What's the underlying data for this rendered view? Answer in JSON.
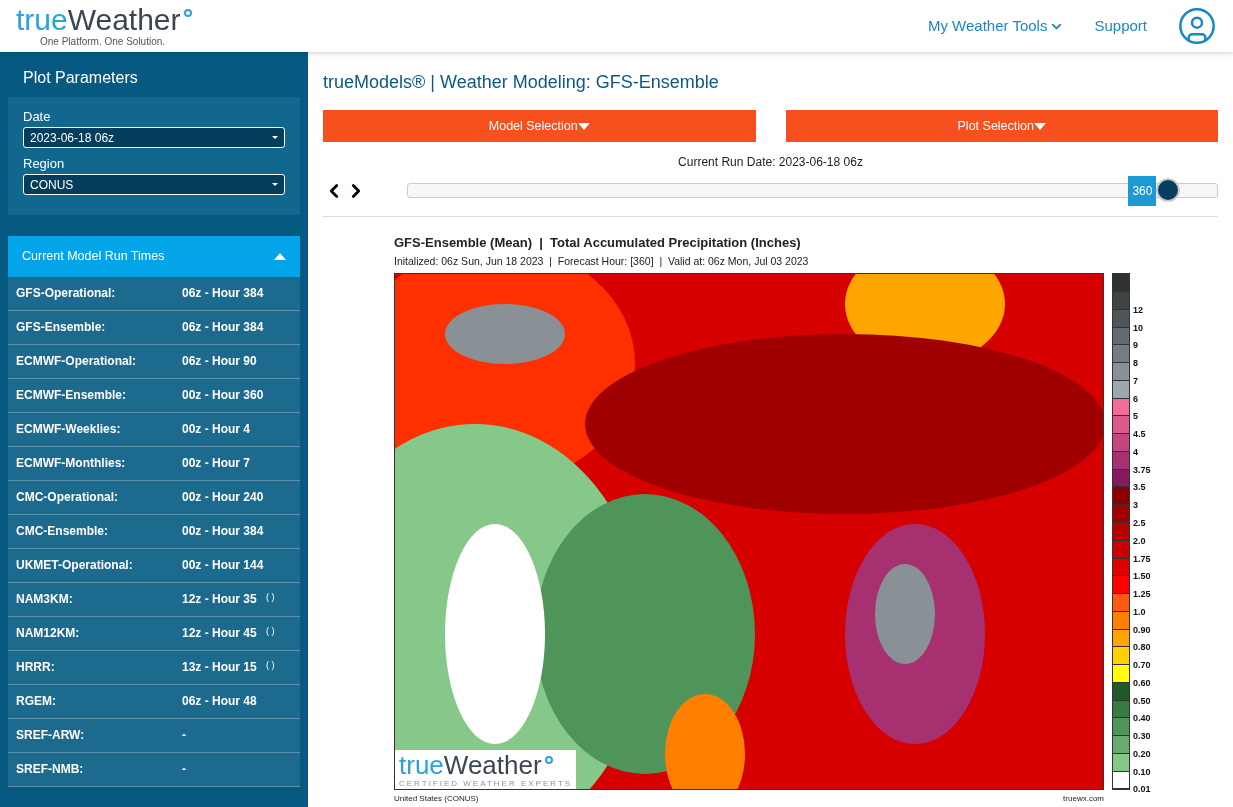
{
  "header": {
    "logo": {
      "first": "true",
      "second": "Weather",
      "tagline": "One Platform. One Solution."
    },
    "nav": [
      {
        "label": "My Weather Tools",
        "kind": "dropdown"
      },
      {
        "label": "Support",
        "kind": "link"
      }
    ]
  },
  "sidebar": {
    "title": "Plot Parameters",
    "fields": [
      {
        "label": "Date",
        "value": "2023-06-18 06z"
      },
      {
        "label": "Region",
        "value": "CONUS"
      }
    ],
    "run_times": {
      "title": "Current Model Run Times",
      "expanded": true,
      "rows": [
        {
          "model": "GFS-Operational:",
          "time": "06z - Hour 384"
        },
        {
          "model": "GFS-Ensemble:",
          "time": "06z - Hour 384"
        },
        {
          "model": "ECMWF-Operational:",
          "time": "06z - Hour 90"
        },
        {
          "model": "ECMWF-Ensemble:",
          "time": "00z - Hour 360"
        },
        {
          "model": "ECMWF-Weeklies:",
          "time": "00z - Hour 4"
        },
        {
          "model": "ECMWF-Monthlies:",
          "time": "00z - Hour 7"
        },
        {
          "model": "CMC-Operational:",
          "time": "00z - Hour 240"
        },
        {
          "model": "CMC-Ensemble:",
          "time": "00z - Hour 384"
        },
        {
          "model": "UKMET-Operational:",
          "time": "00z - Hour 144"
        },
        {
          "model": "NAM3KM:",
          "time": "12z - Hour 35",
          "note": "( )"
        },
        {
          "model": "NAM12KM:",
          "time": "12z - Hour 45",
          "note": "( )"
        },
        {
          "model": "HRRR:",
          "time": "13z - Hour 15",
          "note": "( )"
        },
        {
          "model": "RGEM:",
          "time": "06z - Hour 48"
        },
        {
          "model": "SREF-ARW:",
          "time": "-"
        },
        {
          "model": "SREF-NMB:",
          "time": "-"
        }
      ]
    }
  },
  "main": {
    "title": "trueModels® | Weather Modeling: GFS-Ensemble",
    "buttons": [
      "Model Selection",
      "Plot Selection"
    ],
    "run_date": "Current Run Date: 2023-06-18 06z",
    "slider": {
      "value": "360",
      "level": 0.94
    },
    "plot": {
      "title": "GFS-Ensemble (Mean)  |  Total Accumulated Precipitation (Inches)",
      "subtitle": "Initalized: 06z Sun, Jun 18 2023  |  Forecast Hour: [360]  |  Valid at: 06z Mon, Jul 03 2023",
      "map_logo": {
        "first": "true",
        "second": "Weather",
        "tagline": "CERTIFIED WEATHER EXPERTS"
      },
      "footer_left": "United States (CONUS)",
      "footer_right": "truewx.com",
      "legend": [
        {
          "color": "#2f3331"
        },
        {
          "label": "12",
          "color": "#3f4442"
        },
        {
          "label": "10",
          "color": "#50555a"
        },
        {
          "label": "9",
          "color": "#646a70"
        },
        {
          "label": "8",
          "color": "#767d82"
        },
        {
          "label": "7",
          "color": "#8a9196"
        },
        {
          "label": "6",
          "color": "#9ea7ae"
        },
        {
          "label": "5",
          "color": "#f06d98"
        },
        {
          "label": "4.5",
          "color": "#dc5a8c"
        },
        {
          "label": "4",
          "color": "#c24680"
        },
        {
          "label": "3.75",
          "color": "#a63070"
        },
        {
          "label": "3.5",
          "color": "#871a5c"
        },
        {
          "label": "3",
          "color": "#8a0000"
        },
        {
          "label": "2.5",
          "color": "#a00000"
        },
        {
          "label": "2.0",
          "color": "#b80000"
        },
        {
          "label": "1.75",
          "color": "#cc0000"
        },
        {
          "label": "1.50",
          "color": "#e00000"
        },
        {
          "label": "1.25",
          "color": "#ff0000"
        },
        {
          "label": "1.0",
          "color": "#ff5a10"
        },
        {
          "label": "0.90",
          "color": "#ff8000"
        },
        {
          "label": "0.80",
          "color": "#ffa500"
        },
        {
          "label": "0.70",
          "color": "#ffd000"
        },
        {
          "label": "0.60",
          "color": "#ffff00"
        },
        {
          "label": "0.50",
          "color": "#1e5a28"
        },
        {
          "label": "0.40",
          "color": "#377a42"
        },
        {
          "label": "0.30",
          "color": "#4f955a"
        },
        {
          "label": "0.20",
          "color": "#68aa70"
        },
        {
          "label": "0.10",
          "color": "#86c88a"
        },
        {
          "label": "0.01",
          "color": "#ffffff"
        }
      ]
    }
  }
}
